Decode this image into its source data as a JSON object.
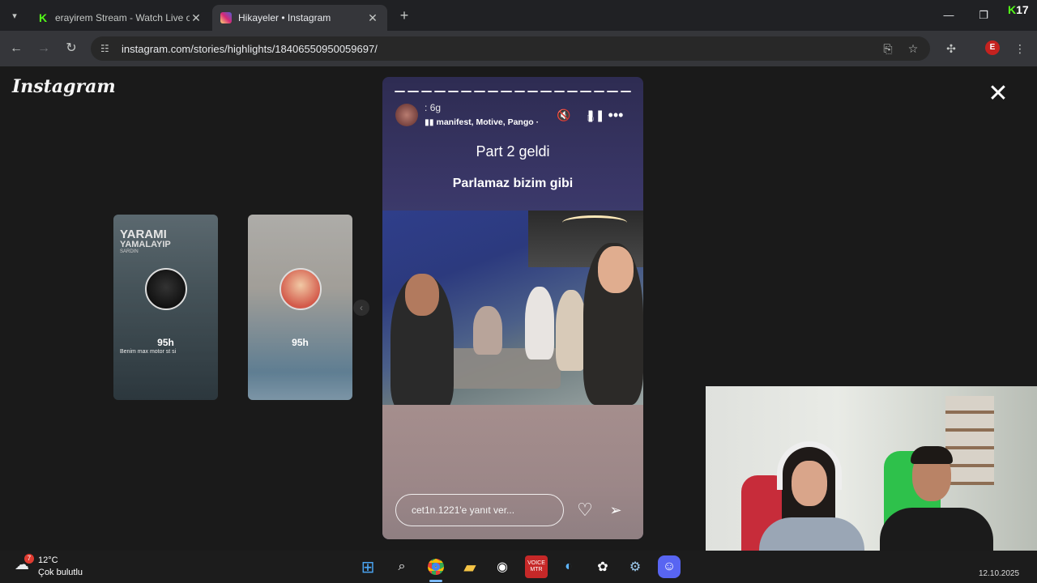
{
  "browser": {
    "tabs": [
      {
        "title": "erayirem Stream - Watch Live o",
        "favicon": "kick-icon",
        "favicon_color": "#53fc18"
      },
      {
        "title": "Hikayeler • Instagram",
        "favicon": "instagram-icon",
        "favicon_color": "#d62976",
        "active": true
      }
    ],
    "url": "instagram.com/stories/highlights/18406550950059697/",
    "profile_initial": "E",
    "profile_color": "#c5221f",
    "overlay_badge": {
      "k": "K",
      "num": "17"
    }
  },
  "instagram": {
    "logo": "Instagram",
    "close_symbol": "✕"
  },
  "previews": [
    {
      "caption_big": "YARAMI",
      "caption_mid": "YAMALAYIP",
      "caption_small": "SARDIN",
      "time": "95h",
      "tiny_text": "Benim max motor st si"
    },
    {
      "time": "95h"
    }
  ],
  "story": {
    "username_prefix": ":",
    "age": "6g",
    "music": "manifest, Motive, Pango ·",
    "text1": "Part 2 geldi",
    "text2": "Parlamaz bizim gibi",
    "reply_placeholder": "cet1n.1221'e yanıt ver...",
    "progress_segments": 18
  },
  "taskbar": {
    "weather_temp": "12°C",
    "weather_desc": "Çok bulutlu",
    "weather_badge": "7",
    "clock": "12.10.2025"
  }
}
